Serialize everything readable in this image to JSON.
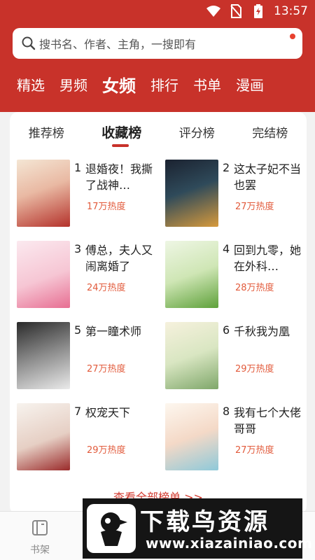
{
  "status_bar": {
    "time": "13:57",
    "icons": [
      "wifi-icon",
      "no-sim-icon",
      "battery-charging-icon"
    ]
  },
  "search": {
    "placeholder": "搜书名、作者、主角，一搜即有",
    "icon": "search-icon"
  },
  "nav": {
    "items": [
      {
        "label": "精选"
      },
      {
        "label": "男频"
      },
      {
        "label": "女频",
        "active": true
      },
      {
        "label": "排行"
      },
      {
        "label": "书单"
      },
      {
        "label": "漫画"
      }
    ]
  },
  "ranking_tabs": [
    {
      "label": "推荐榜"
    },
    {
      "label": "收藏榜",
      "active": true
    },
    {
      "label": "评分榜"
    },
    {
      "label": "完结榜"
    }
  ],
  "books": [
    {
      "rank": "1",
      "title": "退婚夜！我撕了战神…",
      "heat": "17万热度"
    },
    {
      "rank": "2",
      "title": "这太子妃不当也罢",
      "heat": "27万热度"
    },
    {
      "rank": "3",
      "title": "傅总，夫人又闹离婚了",
      "heat": "24万热度"
    },
    {
      "rank": "4",
      "title": "回到九零，她在外科…",
      "heat": "28万热度"
    },
    {
      "rank": "5",
      "title": "第一瞳术师",
      "heat": "27万热度"
    },
    {
      "rank": "6",
      "title": "千秋我为凰",
      "heat": "29万热度"
    },
    {
      "rank": "7",
      "title": "权宠天下",
      "heat": "29万热度"
    },
    {
      "rank": "8",
      "title": "我有七个大佬哥哥",
      "heat": "27万热度"
    }
  ],
  "more_link": "查看全部榜单 >>",
  "bottom_nav": {
    "shelf_label": "书架",
    "shelf_icon": "bookshelf-icon"
  },
  "watermark": {
    "title": "下载鸟资源",
    "url": "www.xiazainiao.com"
  },
  "colors": {
    "brand": "#c8322a",
    "heat": "#e25b3c"
  }
}
